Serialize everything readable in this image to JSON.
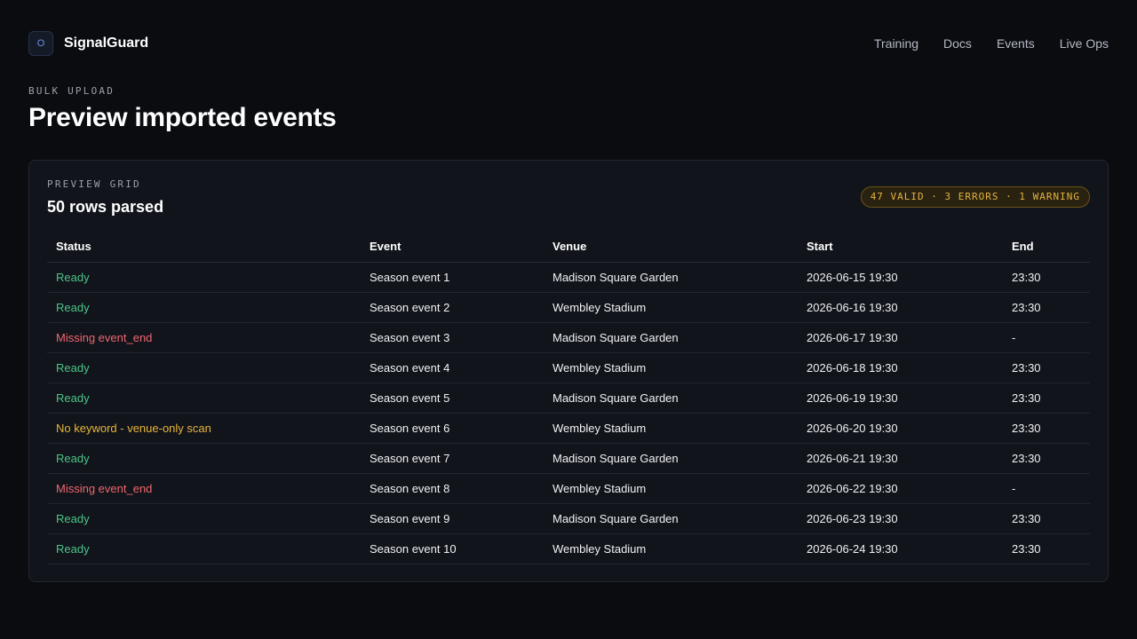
{
  "app": {
    "name": "SignalGuard",
    "logo_glyph": "O",
    "nav": [
      "Training",
      "Docs",
      "Events",
      "Live Ops"
    ]
  },
  "page": {
    "eyebrow": "BULK UPLOAD",
    "title": "Preview imported events"
  },
  "preview": {
    "eyebrow": "PREVIEW GRID",
    "title": "50 rows parsed",
    "summary": "47 VALID · 3 ERRORS · 1 WARNING",
    "columns": [
      "Status",
      "Event",
      "Venue",
      "Start",
      "End"
    ],
    "rows": [
      {
        "status": "Ready",
        "status_type": "ready",
        "event": "Season event 1",
        "venue": "Madison Square Garden",
        "start": "2026-06-15 19:30",
        "end": "23:30"
      },
      {
        "status": "Ready",
        "status_type": "ready",
        "event": "Season event 2",
        "venue": "Wembley Stadium",
        "start": "2026-06-16 19:30",
        "end": "23:30"
      },
      {
        "status": "Missing event_end",
        "status_type": "error",
        "event": "Season event 3",
        "venue": "Madison Square Garden",
        "start": "2026-06-17 19:30",
        "end": "-"
      },
      {
        "status": "Ready",
        "status_type": "ready",
        "event": "Season event 4",
        "venue": "Wembley Stadium",
        "start": "2026-06-18 19:30",
        "end": "23:30"
      },
      {
        "status": "Ready",
        "status_type": "ready",
        "event": "Season event 5",
        "venue": "Madison Square Garden",
        "start": "2026-06-19 19:30",
        "end": "23:30"
      },
      {
        "status": "No keyword - venue-only scan",
        "status_type": "warning",
        "event": "Season event 6",
        "venue": "Wembley Stadium",
        "start": "2026-06-20 19:30",
        "end": "23:30"
      },
      {
        "status": "Ready",
        "status_type": "ready",
        "event": "Season event 7",
        "venue": "Madison Square Garden",
        "start": "2026-06-21 19:30",
        "end": "23:30"
      },
      {
        "status": "Missing event_end",
        "status_type": "error",
        "event": "Season event 8",
        "venue": "Wembley Stadium",
        "start": "2026-06-22 19:30",
        "end": "-"
      },
      {
        "status": "Ready",
        "status_type": "ready",
        "event": "Season event 9",
        "venue": "Madison Square Garden",
        "start": "2026-06-23 19:30",
        "end": "23:30"
      },
      {
        "status": "Ready",
        "status_type": "ready",
        "event": "Season event 10",
        "venue": "Wembley Stadium",
        "start": "2026-06-24 19:30",
        "end": "23:30"
      }
    ]
  },
  "colors": {
    "ready": "#4cc38a",
    "error": "#f06670",
    "warning": "#e8b53c",
    "accent": "#6f8fe8"
  }
}
